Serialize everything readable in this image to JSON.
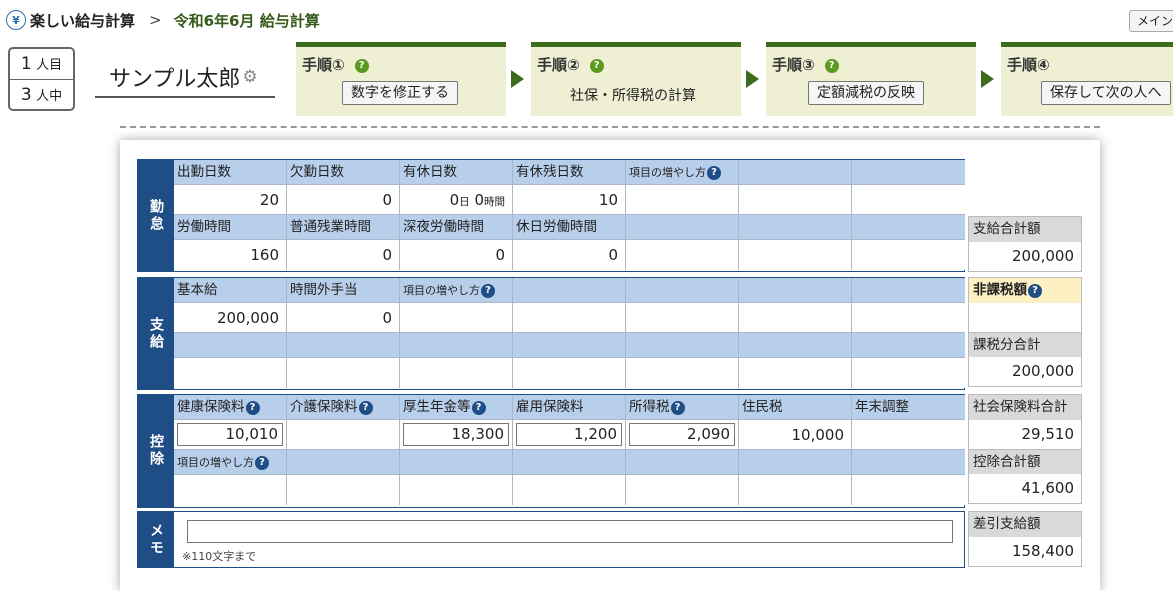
{
  "breadcrumb": {
    "logo": "¥",
    "home": "楽しい給与計算",
    "separator": ">",
    "current": "令和6年6月 給与計算"
  },
  "menu_button": "メイン",
  "person": {
    "current": "1",
    "current_unit": "人目",
    "total": "3",
    "total_unit": "人中"
  },
  "employee_name": "サンプル太郎",
  "steps": [
    {
      "title": "手順①",
      "action": "数字を修正する"
    },
    {
      "title": "手順②",
      "action": "社保・所得税の計算"
    },
    {
      "title": "手順③",
      "action": "定額減税の反映"
    },
    {
      "title": "手順④",
      "action": "保存して次の人へ"
    }
  ],
  "attendance": {
    "label": "勤怠",
    "row1_headers": [
      "出勤日数",
      "欠勤日数",
      "有休日数",
      "有休残日数",
      "項目の増やし方",
      "",
      ""
    ],
    "row1_values": [
      "20",
      "0",
      "",
      "10",
      "",
      "",
      ""
    ],
    "paid_leave": {
      "days": "0",
      "day_unit": "日",
      "hours": "0",
      "hour_unit": "時間"
    },
    "row2_headers": [
      "労働時間",
      "普通残業時間",
      "深夜労働時間",
      "休日労働時間",
      "",
      "",
      ""
    ],
    "row2_values": [
      "160",
      "0",
      "0",
      "0",
      "",
      "",
      ""
    ]
  },
  "payment": {
    "label": "支給",
    "row1_headers": [
      "基本給",
      "時間外手当",
      "項目の増やし方",
      "",
      "",
      "",
      ""
    ],
    "row1_values": [
      "200,000",
      "0",
      "",
      "",
      "",
      "",
      ""
    ]
  },
  "deduction": {
    "label": "控除",
    "row1_headers": [
      "健康保険料",
      "介護保険料",
      "厚生年金等",
      "雇用保険料",
      "所得税",
      "住民税",
      "年末調整"
    ],
    "row1_values": [
      "10,010",
      "",
      "18,300",
      "1,200",
      "2,090",
      "10,000",
      ""
    ],
    "row2_headers": [
      "項目の増やし方",
      "",
      "",
      "",
      "",
      "",
      ""
    ]
  },
  "memo": {
    "label": "メモ",
    "value": "",
    "note": "※110文字まで"
  },
  "summary": {
    "total_payment_label": "支給合計額",
    "total_payment": "200,000",
    "nontaxable_label": "非課税額",
    "nontaxable": "",
    "taxable_label": "課税分合計",
    "taxable": "200,000",
    "social_ins_label": "社会保険料合計",
    "social_ins": "29,510",
    "total_deduction_label": "控除合計額",
    "total_deduction": "41,600",
    "net_pay_label": "差引支給額",
    "net_pay": "158,400"
  },
  "colors": {
    "section_blue": "#1f4d85",
    "header_blue": "#b8cfeb",
    "step_green": "#3d6b1c",
    "step_bg": "#eff0d3"
  }
}
